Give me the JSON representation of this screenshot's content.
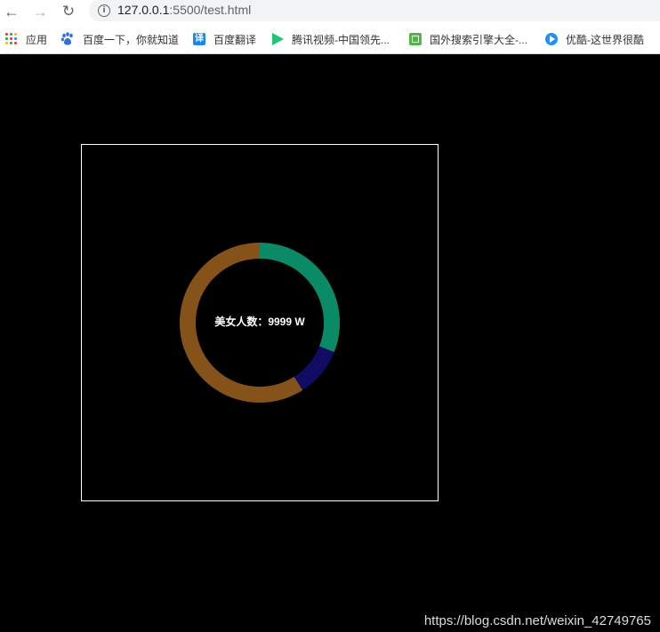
{
  "browser": {
    "url_host": "127.0.0.1",
    "url_rest": ":5500/test.html",
    "bookmarks": [
      {
        "icon": "apps-grid-icon",
        "label": "应用"
      },
      {
        "icon": "baidu-paw-icon",
        "label": "百度一下，你就知道"
      },
      {
        "icon": "translate-icon",
        "label": "百度翻译"
      },
      {
        "icon": "tencent-video-icon",
        "label": "腾讯视频-中国领先..."
      },
      {
        "icon": "search-engine-icon",
        "label": "国外搜索引擎大全-..."
      },
      {
        "icon": "youku-icon",
        "label": "优酷-这世界很酷"
      }
    ]
  },
  "chart": {
    "center_text": "美女人数：9999 W",
    "colors": {
      "border": "#ffffff",
      "background": "#000000"
    }
  },
  "chart_data": {
    "type": "pie",
    "title": "美女人数：9999 W",
    "slices": [
      {
        "value": 31,
        "color": "#0a8a67"
      },
      {
        "value": 10,
        "color": "#0f0c62"
      },
      {
        "value": 59,
        "color": "#85531a"
      }
    ],
    "inner_radius_ratio": 0.8,
    "start": "top",
    "direction": "clockwise"
  },
  "watermark": "https://blog.csdn.net/weixin_42749765"
}
